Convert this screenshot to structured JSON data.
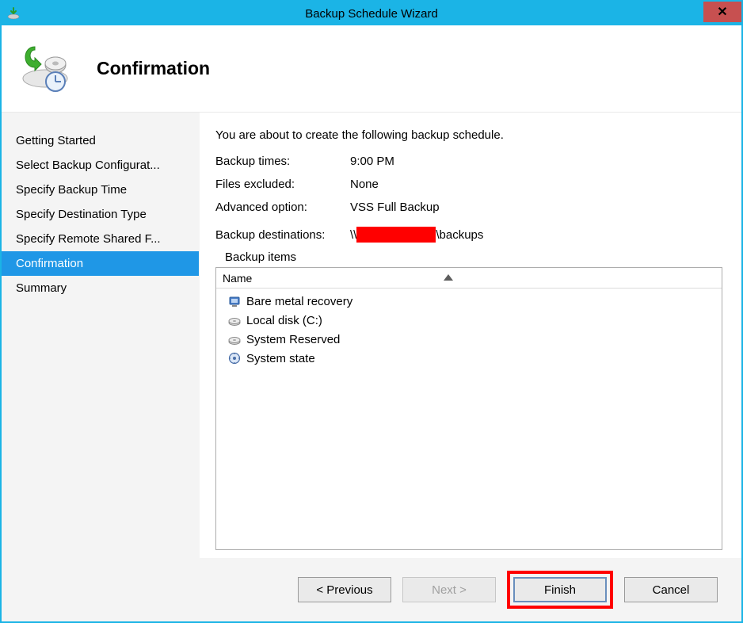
{
  "window": {
    "title": "Backup Schedule Wizard"
  },
  "header": {
    "page_title": "Confirmation"
  },
  "sidebar": {
    "items": [
      {
        "label": "Getting Started",
        "active": false
      },
      {
        "label": "Select Backup Configurat...",
        "active": false
      },
      {
        "label": "Specify Backup Time",
        "active": false
      },
      {
        "label": "Specify Destination Type",
        "active": false
      },
      {
        "label": "Specify Remote Shared F...",
        "active": false
      },
      {
        "label": "Confirmation",
        "active": true
      },
      {
        "label": "Summary",
        "active": false
      }
    ]
  },
  "content": {
    "intro": "You are about to create the following backup schedule.",
    "fields": {
      "backup_times_label": "Backup times:",
      "backup_times_value": "9:00 PM",
      "files_excluded_label": "Files excluded:",
      "files_excluded_value": "None",
      "advanced_option_label": "Advanced option:",
      "advanced_option_value": "VSS Full Backup",
      "backup_destinations_label": "Backup destinations:",
      "backup_destinations_prefix": "\\\\",
      "backup_destinations_suffix": "\\backups"
    },
    "backup_items": {
      "label": "Backup items",
      "column": "Name",
      "rows": [
        {
          "icon": "bare-metal-icon",
          "label": "Bare metal recovery"
        },
        {
          "icon": "disk-icon",
          "label": "Local disk (C:)"
        },
        {
          "icon": "disk-icon",
          "label": "System Reserved"
        },
        {
          "icon": "system-state-icon",
          "label": "System state"
        }
      ]
    }
  },
  "footer": {
    "previous": "< Previous",
    "next": "Next >",
    "finish": "Finish",
    "cancel": "Cancel"
  }
}
